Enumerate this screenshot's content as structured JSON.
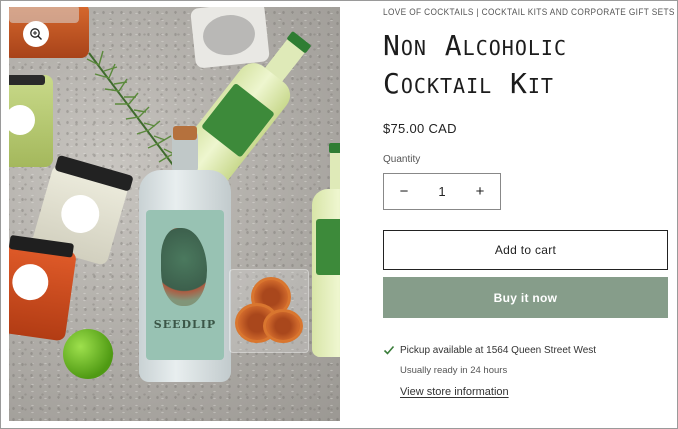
{
  "product": {
    "vendor": "LOVE OF COCKTAILS | COCKTAIL KITS AND CORPORATE GIFT SETS",
    "title_line1": "Non Alcoholic",
    "title_line2": "Cocktail Kit",
    "price": "$75.00 CAD"
  },
  "quantity": {
    "label": "Quantity",
    "value": "1",
    "decrease_symbol": "−",
    "increase_symbol": "+"
  },
  "actions": {
    "add_to_cart": "Add to cart",
    "buy_now": "Buy it now"
  },
  "pickup": {
    "availability": "Pickup available at 1564 Queen Street West",
    "ready": "Usually ready in 24 hours",
    "store_link": "View store information"
  },
  "image": {
    "bottle_label_text": "SEEDLIP",
    "zoom_icon": "magnifier-plus-icon"
  },
  "colors": {
    "buy_now_bg": "#869d8a",
    "check_color": "#3a7d3a"
  }
}
